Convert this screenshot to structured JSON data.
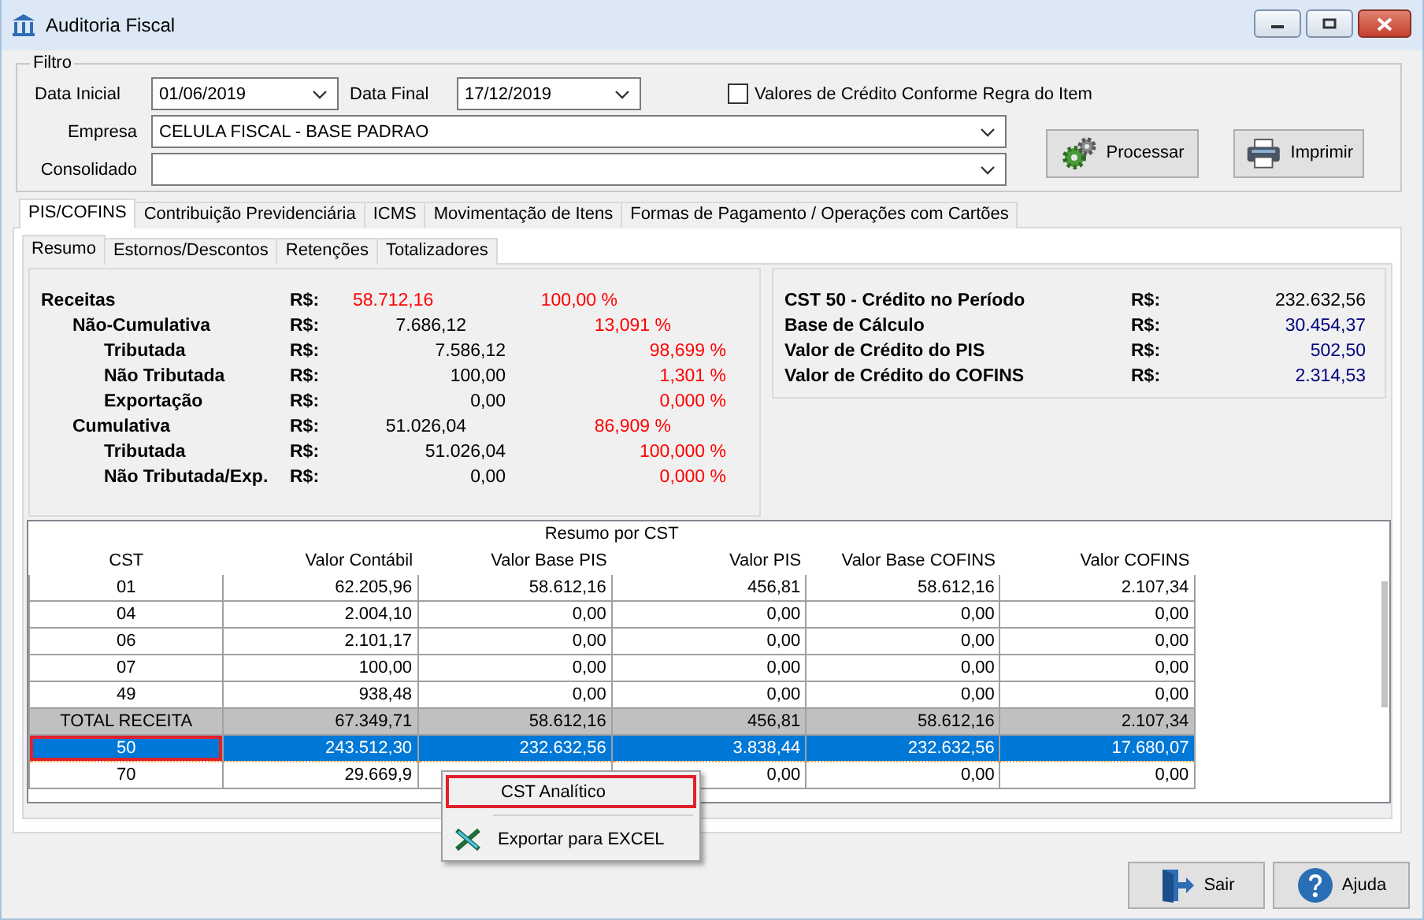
{
  "window": {
    "title": "Auditoria Fiscal"
  },
  "filter": {
    "title": "Filtro",
    "date_start": {
      "label": "Data Inicial",
      "value": "01/06/2019"
    },
    "date_end": {
      "label": "Data Final",
      "value": "17/12/2019"
    },
    "checkbox": {
      "label": "Valores de Crédito Conforme Regra do Item",
      "checked": false
    },
    "company": {
      "label": "Empresa",
      "value": "CELULA FISCAL - BASE PADRAO"
    },
    "consolidated": {
      "label": "Consolidado"
    },
    "buttons": [
      {
        "label": "Processar",
        "kind": "process"
      },
      {
        "label": "Imprimir",
        "kind": "print"
      }
    ]
  },
  "tabs": [
    {
      "label": "PIS/COFINS",
      "selected": true
    },
    {
      "label": "Contribuição Previdenciária",
      "selected": false
    },
    {
      "label": "ICMS",
      "selected": false
    },
    {
      "label": "Movimentação de Itens",
      "selected": false
    },
    {
      "label": "Formas de Pagamento / Operações com Cartões",
      "selected": false
    }
  ],
  "subtabs": [
    {
      "label": "Resumo",
      "selected": true
    },
    {
      "label": "Estornos/Descontos",
      "selected": false
    },
    {
      "label": "Retenções",
      "selected": false
    },
    {
      "label": "Totalizadores",
      "selected": false
    }
  ],
  "revenue": {
    "label": "Receitas",
    "currency": "R$:",
    "value": "58.712,16",
    "percent": "100,00 %",
    "highlighted": true,
    "children": [
      {
        "label": "Não-Cumulativa",
        "currency": "R$:",
        "value": "7.686,12",
        "percent": "13,091 %",
        "highlighted": false,
        "children": [
          {
            "label": "Tributada",
            "currency": "R$:",
            "value": "7.586,12",
            "percent": "98,699 %",
            "highlighted": false
          },
          {
            "label": "Não Tributada",
            "currency": "R$:",
            "value": "100,00",
            "percent": "1,301 %",
            "highlighted": false
          },
          {
            "label": "Exportação",
            "currency": "R$:",
            "value": "0,00",
            "percent": "0,000 %",
            "highlighted": false
          }
        ]
      },
      {
        "label": "Cumulativa",
        "currency": "R$:",
        "value": "51.026,04",
        "percent": "86,909 %",
        "highlighted": false,
        "children": [
          {
            "label": "Tributada",
            "currency": "R$:",
            "value": "51.026,04",
            "percent": "100,000 %",
            "highlighted": false
          },
          {
            "label": "Não Tributada/Exp.",
            "currency": "R$:",
            "value": "0,00",
            "percent": "0,000 %",
            "highlighted": false
          }
        ]
      }
    ]
  },
  "credit_summary": [
    {
      "label": "CST 50 - Crédito no Período",
      "currency": "R$:",
      "value": "232.632,56",
      "color": "#000000"
    },
    {
      "label": "Base de Cálculo",
      "currency": "R$:",
      "value": "30.454,37",
      "color": "#000080"
    },
    {
      "label": "Valor de Crédito do PIS",
      "currency": "R$:",
      "value": "502,50",
      "color": "#000080"
    },
    {
      "label": "Valor de Crédito do COFINS",
      "currency": "R$:",
      "value": "2.314,53",
      "color": "#000080"
    }
  ],
  "table": {
    "title": "Resumo por CST",
    "columns": [
      "CST",
      "Valor Contábil",
      "Valor Base PIS",
      "Valor PIS",
      "Valor Base COFINS",
      "Valor COFINS"
    ],
    "rows": [
      {
        "kind": "data",
        "selected": false,
        "outlined": false,
        "cells": [
          "01",
          "62.205,96",
          "58.612,16",
          "456,81",
          "58.612,16",
          "2.107,34"
        ]
      },
      {
        "kind": "data",
        "selected": false,
        "outlined": false,
        "cells": [
          "04",
          "2.004,10",
          "0,00",
          "0,00",
          "0,00",
          "0,00"
        ]
      },
      {
        "kind": "data",
        "selected": false,
        "outlined": false,
        "cells": [
          "06",
          "2.101,17",
          "0,00",
          "0,00",
          "0,00",
          "0,00"
        ]
      },
      {
        "kind": "data",
        "selected": false,
        "outlined": false,
        "cells": [
          "07",
          "100,00",
          "0,00",
          "0,00",
          "0,00",
          "0,00"
        ]
      },
      {
        "kind": "data",
        "selected": false,
        "outlined": false,
        "cells": [
          "49",
          "938,48",
          "0,00",
          "0,00",
          "0,00",
          "0,00"
        ]
      },
      {
        "kind": "total",
        "selected": false,
        "outlined": false,
        "cells": [
          "TOTAL RECEITA",
          "67.349,71",
          "58.612,16",
          "456,81",
          "58.612,16",
          "2.107,34"
        ]
      },
      {
        "kind": "data",
        "selected": true,
        "outlined": true,
        "cells": [
          "50",
          "243.512,30",
          "232.632,56",
          "3.838,44",
          "232.632,56",
          "17.680,07"
        ]
      },
      {
        "kind": "data",
        "selected": false,
        "outlined": false,
        "cells": [
          "70",
          "29.669,9",
          null,
          "0,00",
          "0,00",
          "0,00"
        ]
      }
    ]
  },
  "context_menu": [
    {
      "kind": "plain",
      "label": "CST Analítico",
      "highlighted": true
    },
    {
      "kind": "separator"
    },
    {
      "kind": "spreadsheet",
      "label": "Exportar para EXCEL",
      "highlighted": false
    }
  ],
  "footer_buttons": [
    {
      "label": "Sair",
      "kind": "exit"
    },
    {
      "label": "Ajuda",
      "kind": "help"
    }
  ]
}
